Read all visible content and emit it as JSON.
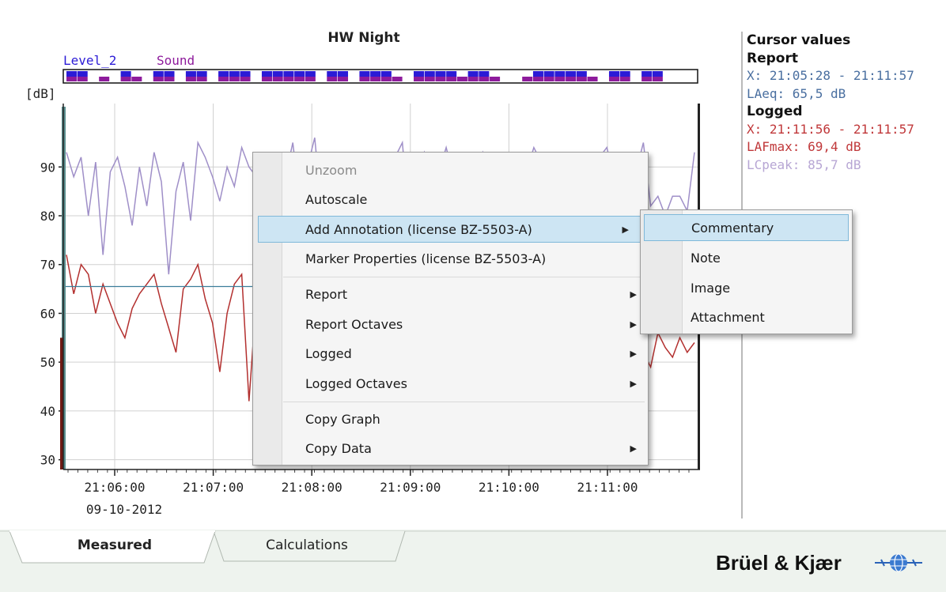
{
  "chart_data": {
    "type": "line",
    "title": "HW Night",
    "ylabel": "[dB]",
    "yticks": [
      30,
      40,
      50,
      60,
      70,
      80,
      90
    ],
    "ylim": [
      28,
      103
    ],
    "xticks": [
      "21:06:00",
      "21:07:00",
      "21:08:00",
      "21:09:00",
      "21:10:00",
      "21:11:00"
    ],
    "xdate": "09-10-2012",
    "grid": true,
    "legend": [
      "Level_2",
      "Sound"
    ],
    "legend_colors": [
      "#2b1bd6",
      "#8e1b9c"
    ],
    "report_laeq": 65.5,
    "series": [
      {
        "name": "LCpeak",
        "color": "#9f8fc8",
        "values": [
          93,
          88,
          92,
          80,
          91,
          72,
          89,
          92,
          86,
          78,
          90,
          82,
          93,
          87,
          68,
          85,
          91,
          79,
          95,
          92,
          88,
          83,
          90,
          86,
          94,
          90,
          88,
          76,
          91,
          62,
          88,
          95,
          82,
          90,
          96,
          80,
          91,
          87,
          72,
          83,
          91,
          79,
          90,
          88,
          84,
          92,
          95,
          78,
          90,
          93,
          86,
          89,
          94,
          88,
          91,
          90,
          89,
          93,
          88,
          90,
          92,
          91,
          90,
          89,
          94,
          91,
          88,
          90,
          92,
          87,
          89,
          91,
          80,
          92,
          94,
          88,
          90,
          91,
          89,
          95,
          82,
          84,
          80,
          84,
          84,
          81,
          93
        ]
      },
      {
        "name": "LAFmax",
        "color": "#b3302f",
        "values": [
          72,
          64,
          70,
          68,
          60,
          66,
          62,
          58,
          55,
          61,
          64,
          66,
          68,
          62,
          57,
          52,
          65,
          67,
          70,
          63,
          58,
          48,
          60,
          66,
          68,
          42,
          63,
          61,
          55,
          70,
          66,
          68,
          64,
          70,
          67,
          72,
          69,
          66,
          68,
          70,
          65,
          67,
          71,
          68,
          66,
          69,
          70,
          67,
          68,
          72,
          69,
          66,
          68,
          70,
          67,
          69,
          68,
          66,
          70,
          71,
          68,
          69,
          67,
          70,
          68,
          69,
          66,
          68,
          70,
          67,
          69,
          71,
          68,
          66,
          69,
          70,
          68,
          50,
          55,
          52,
          49,
          56,
          53,
          51,
          55,
          52,
          54
        ]
      }
    ]
  },
  "cursor_panel": {
    "title": "Cursor values",
    "report_label": "Report",
    "report_x": "X: 21:05:28 - 21:11:57",
    "report_laeq": "LAeq: 65,5 dB",
    "logged_label": "Logged",
    "logged_x": "X: 21:11:56 - 21:11:57",
    "logged_lafmax": "LAFmax: 69,4 dB",
    "logged_lcpeak": "LCpeak: 85,7 dB"
  },
  "context_menu": {
    "unzoom": "Unzoom",
    "autoscale": "Autoscale",
    "add_annotation": "Add Annotation (license BZ-5503-A)",
    "marker_properties": "Marker Properties (license BZ-5503-A)",
    "report": "Report",
    "report_octaves": "Report Octaves",
    "logged": "Logged",
    "logged_octaves": "Logged Octaves",
    "copy_graph": "Copy Graph",
    "copy_data": "Copy Data"
  },
  "submenu": {
    "commentary": "Commentary",
    "note": "Note",
    "image": "Image",
    "attachment": "Attachment"
  },
  "tabs": {
    "measured": "Measured",
    "calculations": "Calculations"
  },
  "brand": {
    "name": "Brüel & Kjær"
  }
}
